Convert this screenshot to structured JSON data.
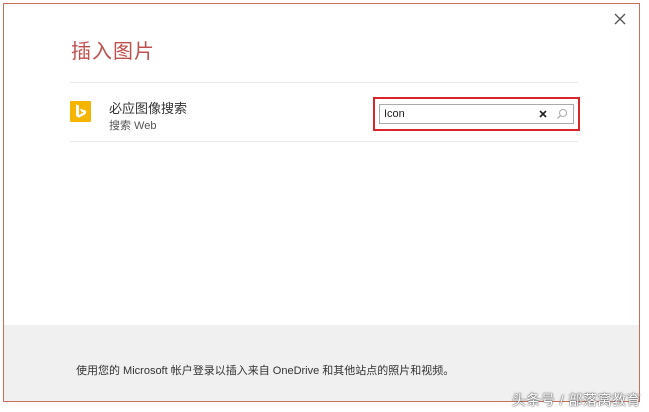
{
  "dialog": {
    "title": "插入图片",
    "close_icon": "close-icon"
  },
  "provider": {
    "logo_icon": "bing-logo-icon",
    "name": "必应图像搜索",
    "subtitle": "搜索 Web"
  },
  "search": {
    "value": "Icon",
    "clear_icon": "clear-icon",
    "search_icon": "search-icon"
  },
  "footer": {
    "message": "使用您的 Microsoft 帐户登录以插入来自 OneDrive 和其他站点的照片和视频。"
  },
  "watermark": {
    "text": "头条号 / 部落窝教育"
  },
  "colors": {
    "title": "#c0504d",
    "dialog_border": "#c9705a",
    "highlight_border": "#d9262b",
    "bing_logo": "#f4b400",
    "footer_background": "#f0f0f0"
  }
}
